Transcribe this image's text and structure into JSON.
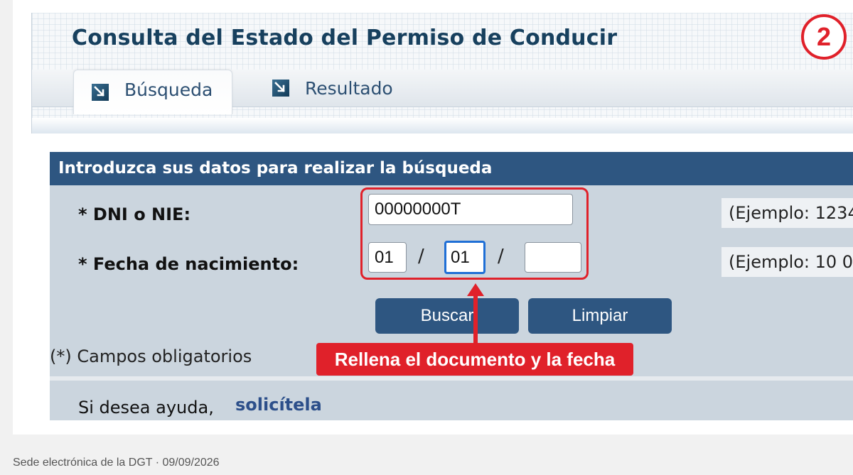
{
  "header": {
    "title": "Consulta del Estado del Permiso de Conducir",
    "step_badge": "2",
    "tabs": [
      {
        "label": "Búsqueda",
        "icon": "arrow-down-right-icon",
        "active": true
      },
      {
        "label": "Resultado",
        "icon": "arrow-down-right-icon",
        "active": false
      }
    ]
  },
  "form": {
    "heading": "Introduzca sus datos para realizar la búsqueda",
    "dni": {
      "label": "* DNI o NIE:",
      "value": "00000000T",
      "example": "(Ejemplo: 1234"
    },
    "birthdate": {
      "label": "* Fecha de nacimiento:",
      "day": "01",
      "month": "01",
      "year": "",
      "separator": "/",
      "example": "(Ejemplo: 10 0"
    },
    "buttons": {
      "search": "Buscar",
      "clear": "Limpiar"
    },
    "required_note": "(*) Campos obligatorios",
    "help": {
      "text": "Si desea ayuda,",
      "link": "solicítela"
    }
  },
  "annotation": {
    "callout": "Rellena el documento y la fecha"
  },
  "footer": {
    "text": "Sede electrónica de la DGT · 09/09/2026"
  },
  "colors": {
    "accent_red": "#e0212a",
    "primary_blue": "#2e5681",
    "panel_gray": "#cbd5de",
    "title_blue": "#17405e"
  }
}
